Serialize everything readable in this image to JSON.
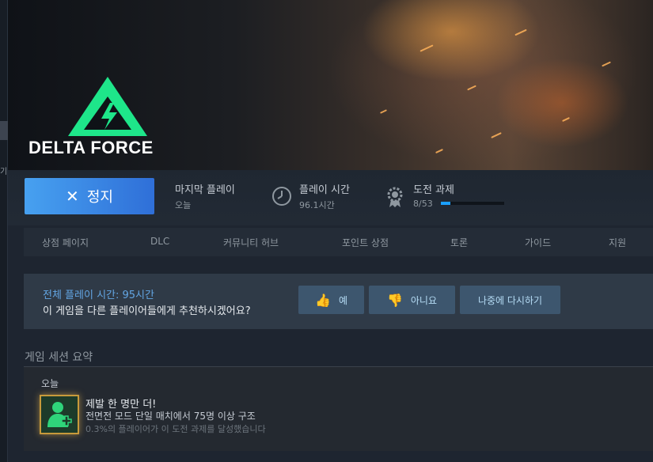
{
  "sidebar": {
    "glyph": "기"
  },
  "hero": {
    "logo_text": "DELTA FORCE"
  },
  "actions": {
    "stop_label": "정지",
    "last_played": {
      "label": "마지막 플레이",
      "value": "오늘"
    },
    "playtime": {
      "label": "플레이 시간",
      "value": "96.1시간"
    },
    "achievements": {
      "label": "도전 과제",
      "value": "8/53",
      "progress": 0.151
    }
  },
  "nav": {
    "items": [
      "상점 페이지",
      "DLC",
      "커뮤니티 허브",
      "포인트 상점",
      "토론",
      "가이드",
      "지원"
    ]
  },
  "recommend": {
    "total_playtime": "전체 플레이 시간: 95시간",
    "question": "이 게임을 다른 플레이어들에게 추천하시겠어요?",
    "yes": "예",
    "no": "아니요",
    "later": "나중에 다시하기"
  },
  "session": {
    "title": "게임 세션 요약",
    "today": "오늘",
    "achievement": {
      "title": "제발 한 명만 더!",
      "desc": "전면전 모드 단일 매치에서 75명 이상 구조",
      "percent": "0.3%의 플레이어가 이 도전 과제를 달성했습니다"
    }
  },
  "colors": {
    "accent": "#1a9fff",
    "logo_green": "#1ee68a",
    "stop_button": "#3b82e0"
  }
}
